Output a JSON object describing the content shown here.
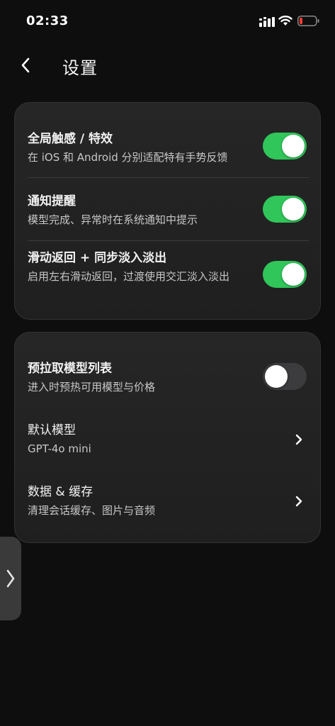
{
  "status_bar": {
    "time": "02:33",
    "icons": [
      "signal-icon",
      "wifi-icon",
      "battery-low-icon"
    ],
    "battery_color": "#ff3b30"
  },
  "nav": {
    "back_icon": "chevron-left-icon",
    "title": "设置"
  },
  "colors": {
    "toggle_on": "#30c65a",
    "toggle_off": "#3c3c3e",
    "card_bg": "#232323"
  },
  "settings_group_1": {
    "items": [
      {
        "title": "全局触感 / 特效",
        "description": "在 iOS 和 Android 分别适配特有手势反馈",
        "enabled": true
      },
      {
        "title": "通知提醒",
        "description": "模型完成、异常时在系统通知中提示",
        "enabled": true
      },
      {
        "title": "滑动返回 + 同步淡入淡出",
        "description": "启用左右滑动返回，过渡使用交汇淡入淡出",
        "enabled": true
      }
    ]
  },
  "settings_group_2": {
    "prefetch": {
      "title": "预拉取模型列表",
      "description": "进入时预热可用模型与价格",
      "enabled": false
    },
    "default_model": {
      "title": "默认模型",
      "value": "GPT-4o mini"
    },
    "data_cache": {
      "title": "数据 & 缓存",
      "description": "清理会话缓存、图片与音频"
    }
  },
  "side_handle": {
    "icon": "chevron-right-icon"
  }
}
